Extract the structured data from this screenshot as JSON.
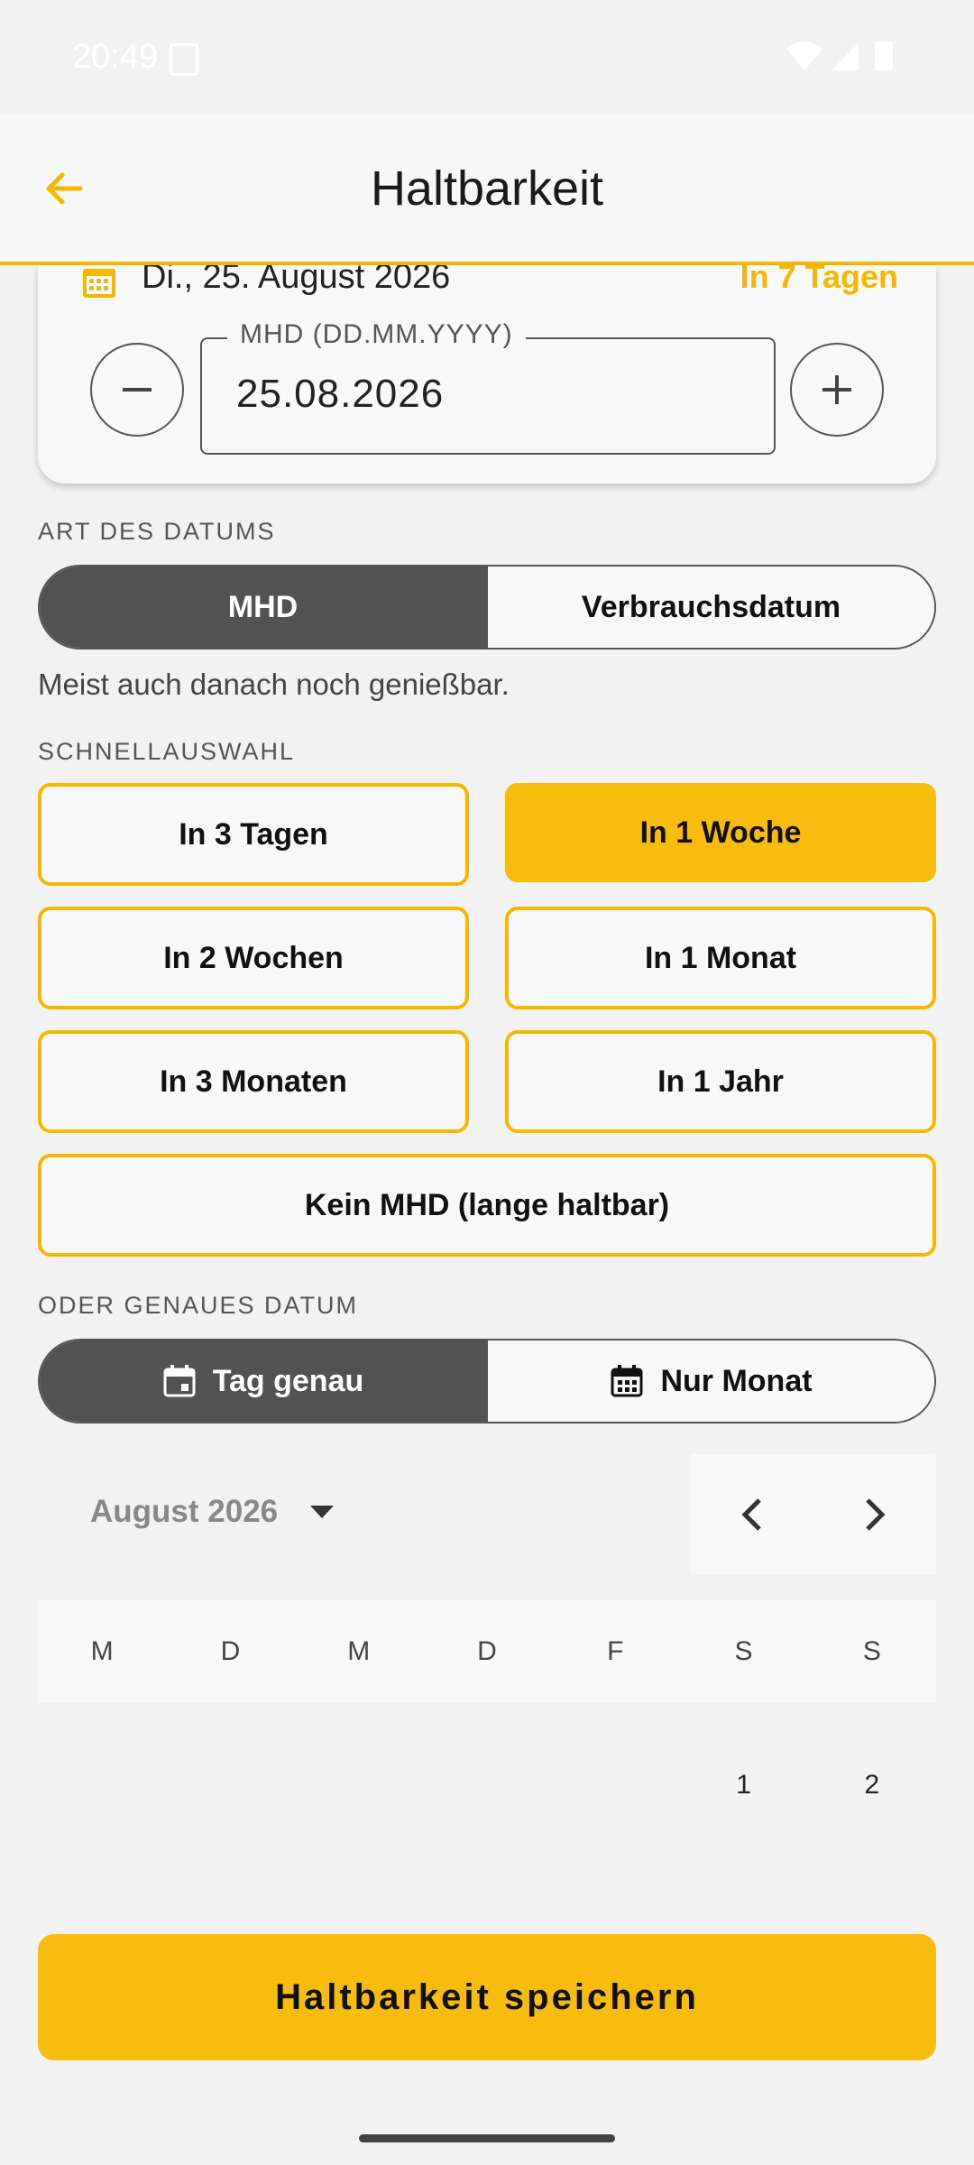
{
  "status_bar": {
    "time": "20:49"
  },
  "app_bar": {
    "title": "Haltbarkeit"
  },
  "date_card": {
    "date_text": "Di., 25. August 2026",
    "relative": "In 7 Tagen",
    "field_label": "MHD (DD.MM.YYYY)",
    "field_value": "25.08.2026"
  },
  "date_type": {
    "heading": "ART DES DATUMS",
    "options": [
      "MHD",
      "Verbrauchsdatum"
    ],
    "selected": "MHD",
    "hint": "Meist auch danach noch genießbar."
  },
  "quick": {
    "heading": "SCHNELLAUSWAHL",
    "options": [
      "In 3 Tagen",
      "In 1 Woche",
      "In 2 Wochen",
      "In 1 Monat",
      "In 3 Monaten",
      "In 1 Jahr",
      "Kein MHD (lange haltbar)"
    ],
    "selected": "In 1 Woche"
  },
  "exact": {
    "heading": "ODER GENAUES DATUM",
    "options": [
      "Tag genau",
      "Nur Monat"
    ],
    "selected": "Tag genau"
  },
  "calendar": {
    "month": "August 2026",
    "weekdays": [
      "M",
      "D",
      "M",
      "D",
      "F",
      "S",
      "S"
    ],
    "first_row": [
      "",
      "",
      "",
      "",
      "",
      "1",
      "2"
    ]
  },
  "save_label": "Haltbarkeit speichern",
  "colors": {
    "accent": "#F7BC0E",
    "selected_segment": "#525252"
  }
}
